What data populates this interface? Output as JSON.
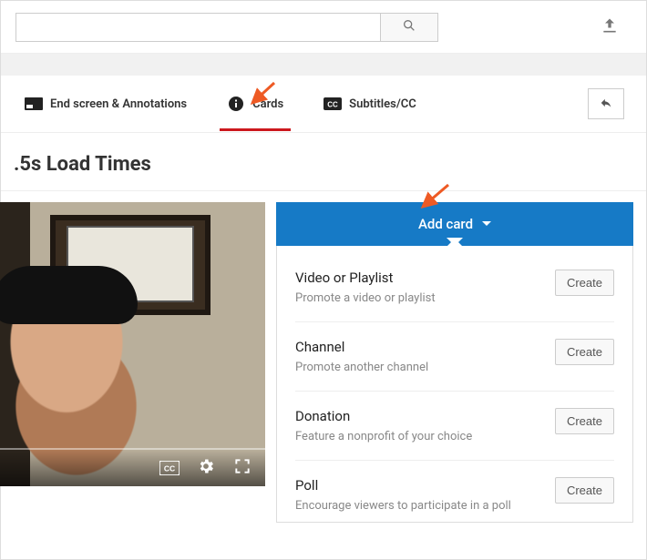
{
  "header": {
    "search_value": "",
    "search_placeholder": ""
  },
  "tabs": {
    "endscreen": {
      "label": "End screen & Annotations"
    },
    "cards": {
      "label": "Cards"
    },
    "subtitles": {
      "label": "Subtitles/CC"
    }
  },
  "page": {
    "title": ".5s Load Times"
  },
  "add_card": {
    "label": "Add card"
  },
  "card_options": [
    {
      "title": "Video or Playlist",
      "desc": "Promote a video or playlist",
      "action": "Create"
    },
    {
      "title": "Channel",
      "desc": "Promote another channel",
      "action": "Create"
    },
    {
      "title": "Donation",
      "desc": "Feature a nonprofit of your choice",
      "action": "Create"
    },
    {
      "title": "Poll",
      "desc": "Encourage viewers to participate in a poll",
      "action": "Create"
    }
  ]
}
